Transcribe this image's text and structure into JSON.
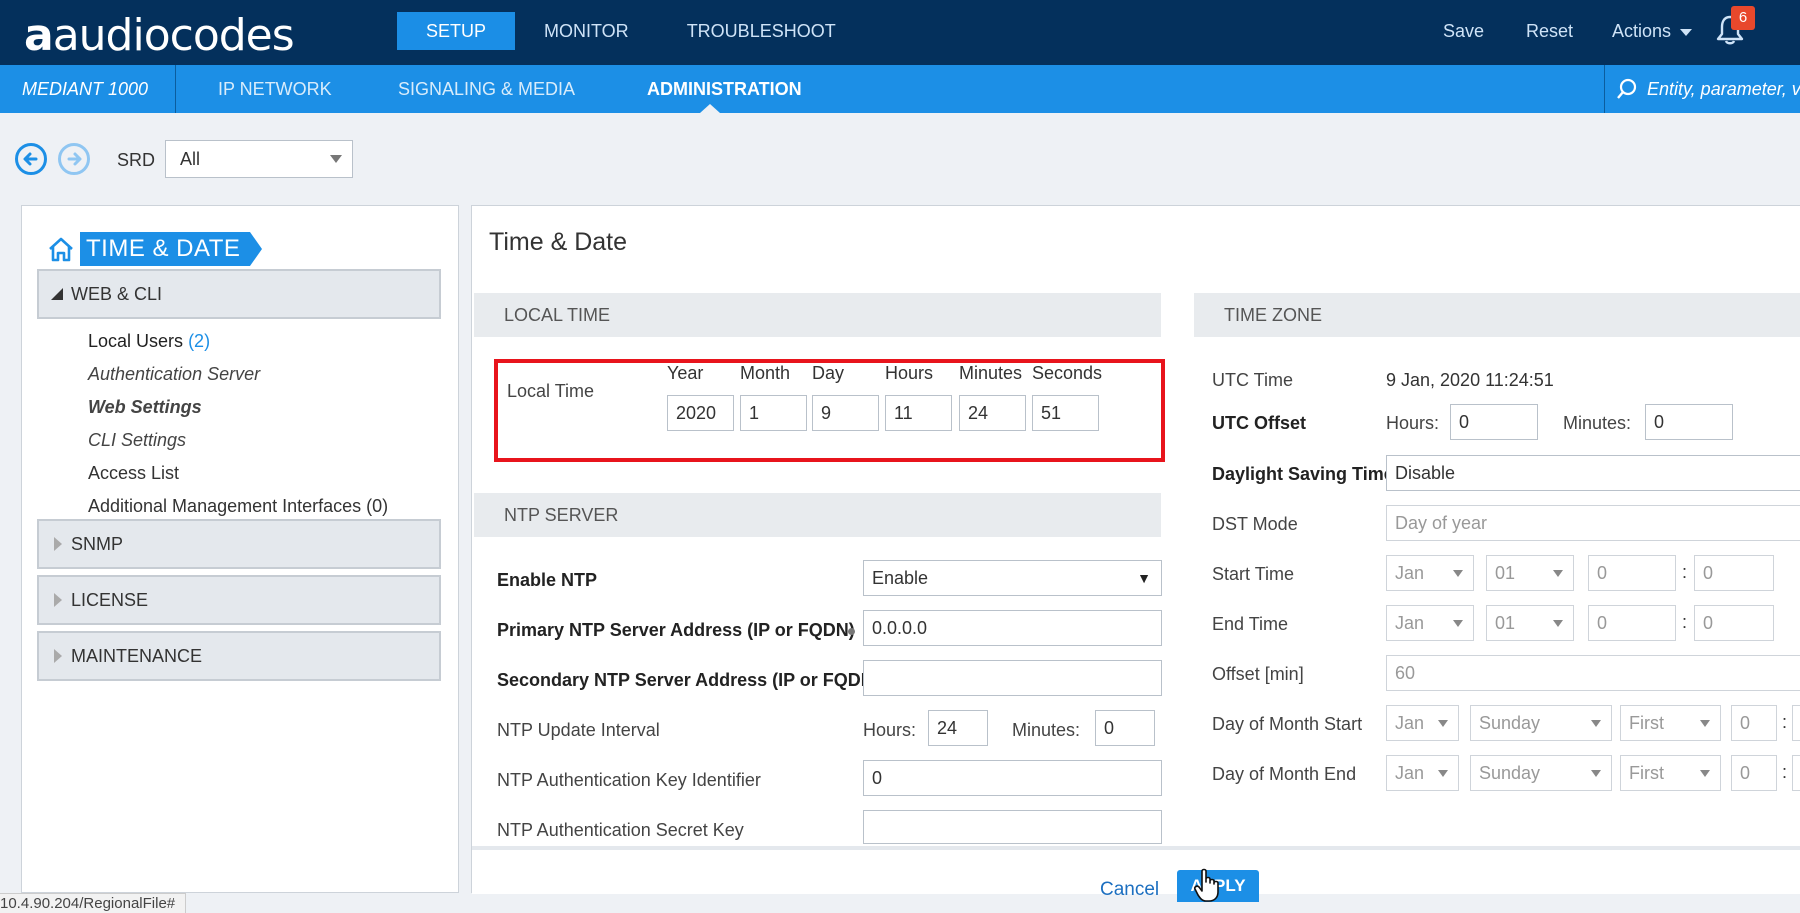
{
  "header": {
    "logo_prefix": "a",
    "logo_text": "audiocodes",
    "nav": [
      "SETUP",
      "MONITOR",
      "TROUBLESHOOT"
    ],
    "save": "Save",
    "reset": "Reset",
    "actions": "Actions",
    "notifications": "6"
  },
  "subnav": {
    "device": "MEDIANT 1000",
    "items": [
      "IP NETWORK",
      "SIGNALING & MEDIA",
      "ADMINISTRATION"
    ],
    "search_placeholder": "Entity, parameter, value"
  },
  "srd": {
    "label": "SRD",
    "value": "All"
  },
  "sidebar": {
    "breadcrumb": "TIME & DATE",
    "section_web_cli": "WEB & CLI",
    "items": [
      {
        "label": "Local Users",
        "count": "(2)"
      },
      {
        "label": "Authentication Server"
      },
      {
        "label": "Web Settings"
      },
      {
        "label": "CLI Settings"
      },
      {
        "label": "Access List"
      },
      {
        "label": "Additional Management Interfaces (0)"
      }
    ],
    "sections": [
      "SNMP",
      "LICENSE",
      "MAINTENANCE"
    ]
  },
  "main": {
    "title": "Time & Date",
    "local_time": {
      "header": "LOCAL TIME",
      "label": "Local Time",
      "columns": [
        "Year",
        "Month",
        "Day",
        "Hours",
        "Minutes",
        "Seconds"
      ],
      "values": [
        "2020",
        "1",
        "9",
        "11",
        "24",
        "51"
      ]
    },
    "ntp": {
      "header": "NTP SERVER",
      "enable_label": "Enable NTP",
      "enable_value": "Enable",
      "primary_label": "Primary NTP Server Address (IP or FQDN)",
      "primary_value": "0.0.0.0",
      "secondary_label": "Secondary NTP Server Address (IP or FQDN)",
      "secondary_value": "",
      "interval_label": "NTP Update Interval",
      "hours_label": "Hours:",
      "hours_value": "24",
      "minutes_label": "Minutes:",
      "minutes_value": "0",
      "key_id_label": "NTP Authentication Key Identifier",
      "key_id_value": "0",
      "secret_label": "NTP Authentication Secret Key",
      "secret_value": ""
    },
    "timezone": {
      "header": "TIME ZONE",
      "utc_time_label": "UTC Time",
      "utc_time_value": "9 Jan, 2020 11:24:51",
      "utc_offset_label": "UTC Offset",
      "hours_label": "Hours:",
      "hours_value": "0",
      "minutes_label": "Minutes:",
      "minutes_value": "0",
      "dst_label": "Daylight Saving Time",
      "dst_value": "Disable",
      "dst_mode_label": "DST Mode",
      "dst_mode_value": "Day of year",
      "start_label": "Start Time",
      "start": [
        "Jan",
        "01",
        "0",
        "0"
      ],
      "end_label": "End Time",
      "end": [
        "Jan",
        "01",
        "0",
        "0"
      ],
      "offset_label": "Offset [min]",
      "offset_value": "60",
      "dom_start_label": "Day of Month Start",
      "dom_start": [
        "Jan",
        "Sunday",
        "First",
        "0"
      ],
      "dom_end_label": "Day of Month End",
      "dom_end": [
        "Jan",
        "Sunday",
        "First",
        "0"
      ]
    },
    "cancel": "Cancel",
    "apply": "APPLY"
  },
  "status_url": "10.4.90.204/RegionalFile#",
  "colors": {
    "topbar": "#04305c",
    "accent": "#1c8fe6",
    "highlight": "#e8141c"
  }
}
